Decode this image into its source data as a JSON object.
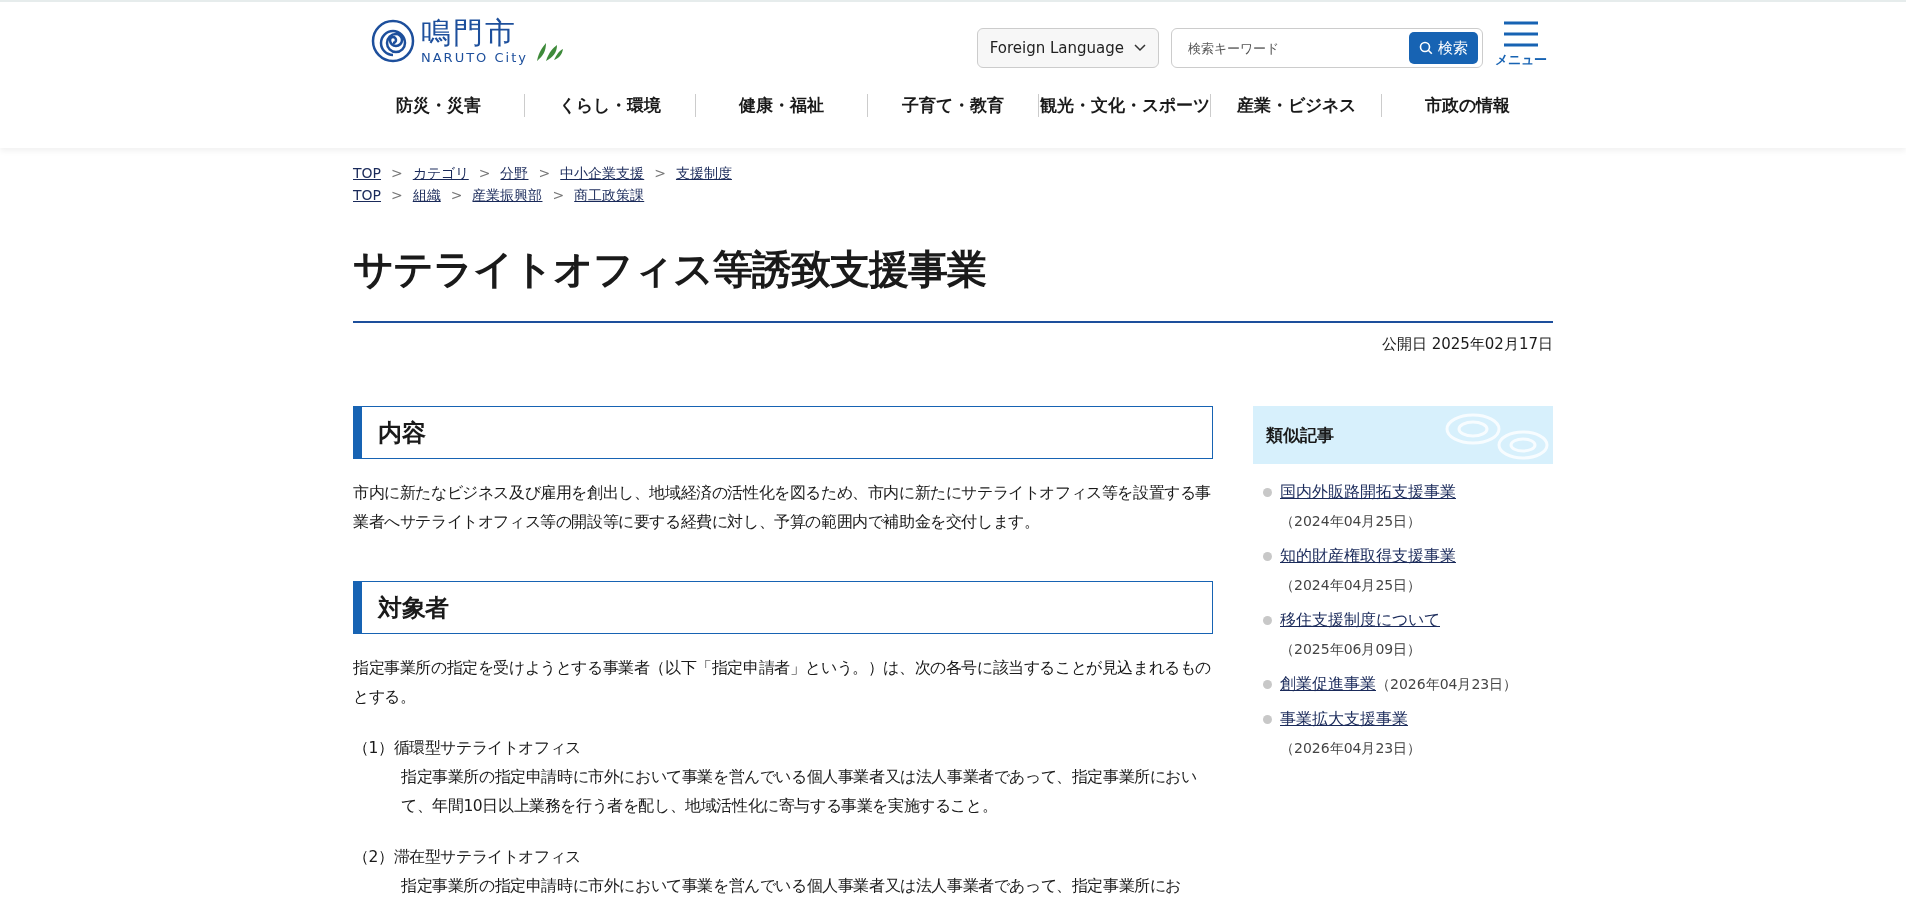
{
  "header": {
    "logo": {
      "name": "鳴門市",
      "sub": "NARUTO City"
    },
    "language_button": "Foreign Language",
    "search": {
      "placeholder": "検索キーワード",
      "button": "検索"
    },
    "menu_button": "メニュー"
  },
  "nav": [
    "防災・災害",
    "くらし・環境",
    "健康・福祉",
    "子育て・教育",
    "観光・文化・スポーツ",
    "産業・ビジネス",
    "市政の情報"
  ],
  "breadcrumbs": [
    [
      "TOP",
      "カテゴリ",
      "分野",
      "中小企業支援",
      "支援制度"
    ],
    [
      "TOP",
      "組織",
      "産業振興部",
      "商工政策課"
    ]
  ],
  "breadcrumb_separator": ">",
  "title": "サテライトオフィス等誘致支援事業",
  "published": "公開日 2025年02月17日",
  "sections": [
    {
      "heading": "内容",
      "paragraphs": [
        "市内に新たなビジネス及び雇用を創出し、地域経済の活性化を図るため、市内に新たにサテライトオフィス等を設置する事業者へサテライトオフィス等の開設等に要する経費に対し、予算の範囲内で補助金を交付します。"
      ]
    },
    {
      "heading": "対象者",
      "paragraphs": [
        "指定事業所の指定を受けようとする事業者（以下「指定申請者」という。）は、次の各号に該当することが見込まれるものとする。"
      ],
      "items": [
        {
          "label": "（1）循環型サテライトオフィス",
          "text": "指定事業所の指定申請時に市外において事業を営んでいる個人事業者又は法人事業者であって、指定事業所において、年間10日以上業務を行う者を配し、地域活性化に寄与する事業を実施すること。"
        },
        {
          "label": "（2）滞在型サテライトオフィス",
          "text": "指定事業所の指定申請時に市外において事業を営んでいる個人事業者又は法人事業者であって、指定事業所にお"
        }
      ]
    }
  ],
  "sidebar": {
    "heading": "類似記事",
    "items": [
      {
        "title": "国内外販路開拓支援事業",
        "date": "（2024年04月25日）",
        "kind": "stacked"
      },
      {
        "title": "知的財産権取得支援事業",
        "date": "（2024年04月25日）",
        "kind": "stacked"
      },
      {
        "title": "移住支援制度について",
        "date": "（2025年06月09日）",
        "kind": "stacked"
      },
      {
        "title": "創業促進事業",
        "date": "（2026年04月23日）",
        "kind": "inline"
      },
      {
        "title": "事業拡大支援事業",
        "date": "（2026年04月23日）",
        "kind": "stacked"
      }
    ]
  }
}
